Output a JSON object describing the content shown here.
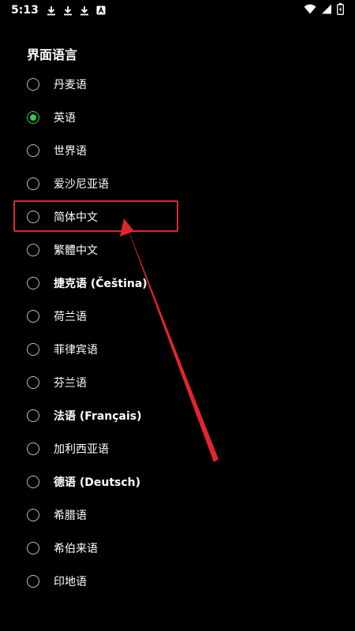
{
  "status_bar": {
    "time": "5:13",
    "left_icons": [
      "download-icon",
      "download-icon",
      "download-icon",
      "a-icon"
    ],
    "right_icons": [
      "wifi-icon",
      "signal-icon",
      "battery-icon"
    ]
  },
  "page": {
    "title": "界面语言"
  },
  "languages": [
    {
      "label": "丹麦语",
      "selected": false
    },
    {
      "label": "英语",
      "selected": true
    },
    {
      "label": "世界语",
      "selected": false
    },
    {
      "label": "爱沙尼亚语",
      "selected": false
    },
    {
      "label": "简体中文",
      "selected": false
    },
    {
      "label": "繁體中文",
      "selected": false
    },
    {
      "label": "捷克语 (Čeština)",
      "selected": false
    },
    {
      "label": "荷兰语",
      "selected": false
    },
    {
      "label": "菲律宾语",
      "selected": false
    },
    {
      "label": "芬兰语",
      "selected": false
    },
    {
      "label": "法语 (Français)",
      "selected": false
    },
    {
      "label": "加利西亚语",
      "selected": false
    },
    {
      "label": "德语 (Deutsch)",
      "selected": false
    },
    {
      "label": "希腊语",
      "selected": false
    },
    {
      "label": "希伯来语",
      "selected": false
    },
    {
      "label": "印地语",
      "selected": false
    }
  ],
  "colors": {
    "accent": "#34c759",
    "annotation": "#e0262c",
    "background": "#000000"
  }
}
